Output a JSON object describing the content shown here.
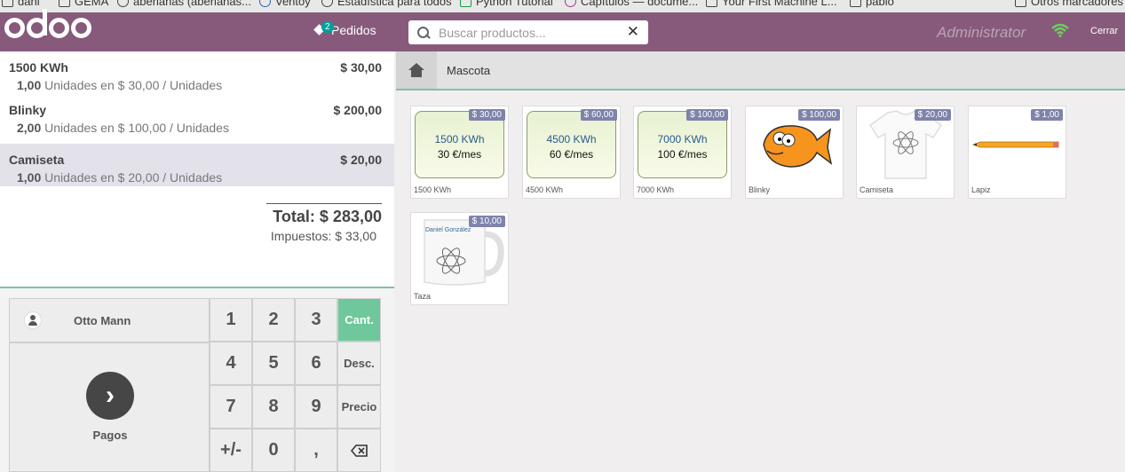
{
  "bookmarks": [
    {
      "label": "dani",
      "icon": "folder-icon"
    },
    {
      "label": "GEMA",
      "icon": "folder-icon"
    },
    {
      "label": "aberlanas (aberlanas...",
      "icon": "github-icon"
    },
    {
      "label": "Ventoy",
      "icon": "ventoy-icon"
    },
    {
      "label": "Estadística para todos",
      "icon": "globe-icon"
    },
    {
      "label": "Python Tutorial",
      "icon": "python-icon"
    },
    {
      "label": "Capítulos — docume...",
      "icon": "docs-icon"
    },
    {
      "label": "Your First Machine L...",
      "icon": "monitor-icon"
    },
    {
      "label": "pablo",
      "icon": "folder-icon"
    },
    {
      "label": "Otros marcadores",
      "icon": "folder-icon"
    }
  ],
  "header": {
    "orders_label": "Pedidos",
    "orders_count": "2",
    "search_placeholder": "Buscar productos...",
    "user": "Administrator",
    "close_label": "Cerrar"
  },
  "order": {
    "lines": [
      {
        "name": "1500 KWh",
        "price": "$ 30,00",
        "qty": "1,00",
        "detail": "Unidades en $ 30,00 / Unidades"
      },
      {
        "name": "Blinky",
        "price": "$ 200,00",
        "qty": "2,00",
        "detail": "Unidades en $ 100,00 / Unidades"
      },
      {
        "name": "Camiseta",
        "price": "$ 20,00",
        "qty": "1,00",
        "detail": "Unidades en $ 20,00 / Unidades"
      }
    ],
    "total": "Total: $ 283,00",
    "taxes": "Impuestos: $ 33,00"
  },
  "actions": {
    "customer": "Otto Mann",
    "payment_label": "Pagos",
    "keys": [
      "1",
      "2",
      "3",
      "4",
      "5",
      "6",
      "7",
      "8",
      "9",
      "+/-",
      "0",
      ","
    ],
    "modes": [
      "Cant.",
      "Desc.",
      "Precio"
    ],
    "active_mode": "Cant."
  },
  "category": {
    "breadcrumb": "Mascota"
  },
  "products": [
    {
      "name": "1500 KWh",
      "price": "$ 30,00",
      "energy": "1500 KWh",
      "rate": "30 €/mes"
    },
    {
      "name": "4500 KWh",
      "price": "$ 60,00",
      "energy": "4500 KWh",
      "rate": "60 €/mes"
    },
    {
      "name": "7000 KWh",
      "price": "$ 100,00",
      "energy": "7000 KWh",
      "rate": "100 €/mes"
    },
    {
      "name": "Blinky",
      "price": "$ 100,00"
    },
    {
      "name": "Camiseta",
      "price": "$ 20,00"
    },
    {
      "name": "Lapiz",
      "price": "$ 1,00"
    },
    {
      "name": "Taza",
      "price": "$ 10,00",
      "mug_text": "Daniel González"
    }
  ],
  "colors": {
    "header": "#875a7b",
    "accent_green": "#6ec89b",
    "price_tag": "#7f82ac",
    "selected_line": "#e3e2eb"
  }
}
